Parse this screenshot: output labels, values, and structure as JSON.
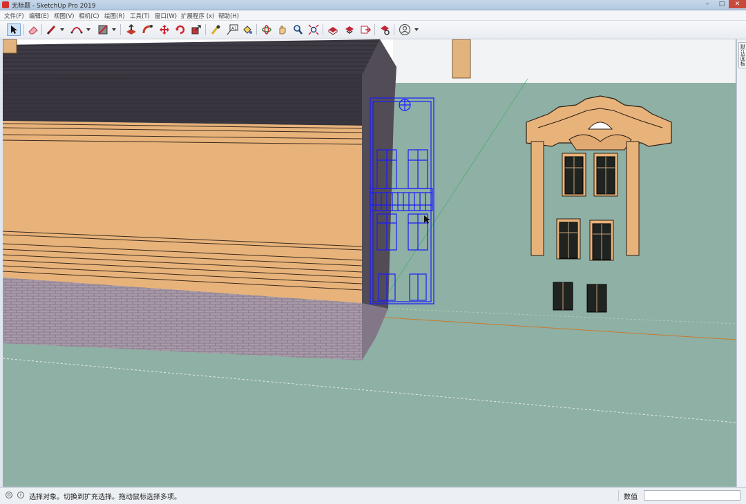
{
  "window": {
    "title": "无标题 - SketchUp Pro 2019",
    "minimize": "–",
    "maximize": "□",
    "close": "✕"
  },
  "menu": [
    {
      "label": "文件(F)"
    },
    {
      "label": "编辑(E)"
    },
    {
      "label": "视图(V)"
    },
    {
      "label": "相机(C)"
    },
    {
      "label": "绘图(R)"
    },
    {
      "label": "工具(T)"
    },
    {
      "label": "窗口(W)"
    },
    {
      "label": "扩展程序 (x)"
    },
    {
      "label": "帮助(H)"
    }
  ],
  "toolbar": {
    "tools": [
      "select-tool-icon",
      "eraser-tool-icon",
      "line-tool-icon",
      "arc-tool-icon",
      "rectangle-tool-icon",
      "push-pull-tool-icon",
      "follow-me-tool-icon",
      "move-tool-icon",
      "rotate-tool-icon",
      "scale-tool-icon",
      "tape-measure-tool-icon",
      "text-tool-icon",
      "paint-bucket-tool-icon",
      "orbit-tool-icon",
      "pan-tool-icon",
      "zoom-tool-icon",
      "zoom-extents-tool-icon",
      "warehouse-icon",
      "extension-warehouse-icon",
      "send-to-layout-icon",
      "extension-manager-icon",
      "account-icon"
    ],
    "active_tool": "select-tool-icon"
  },
  "tray": {
    "label": "默认面板"
  },
  "viewport": {
    "sky_color": "#ffffff",
    "ground_color": "#8fb0a4",
    "selection_color": "#1a1aff",
    "axis_colors": {
      "red": "#c0392b",
      "green": "#27ae60",
      "blue": "#2e4bd6"
    }
  },
  "status": {
    "text": "选择对象。切换到扩充选择。拖动鼠标选择多项。",
    "measurements_label": "数值",
    "measurements_value": ""
  }
}
